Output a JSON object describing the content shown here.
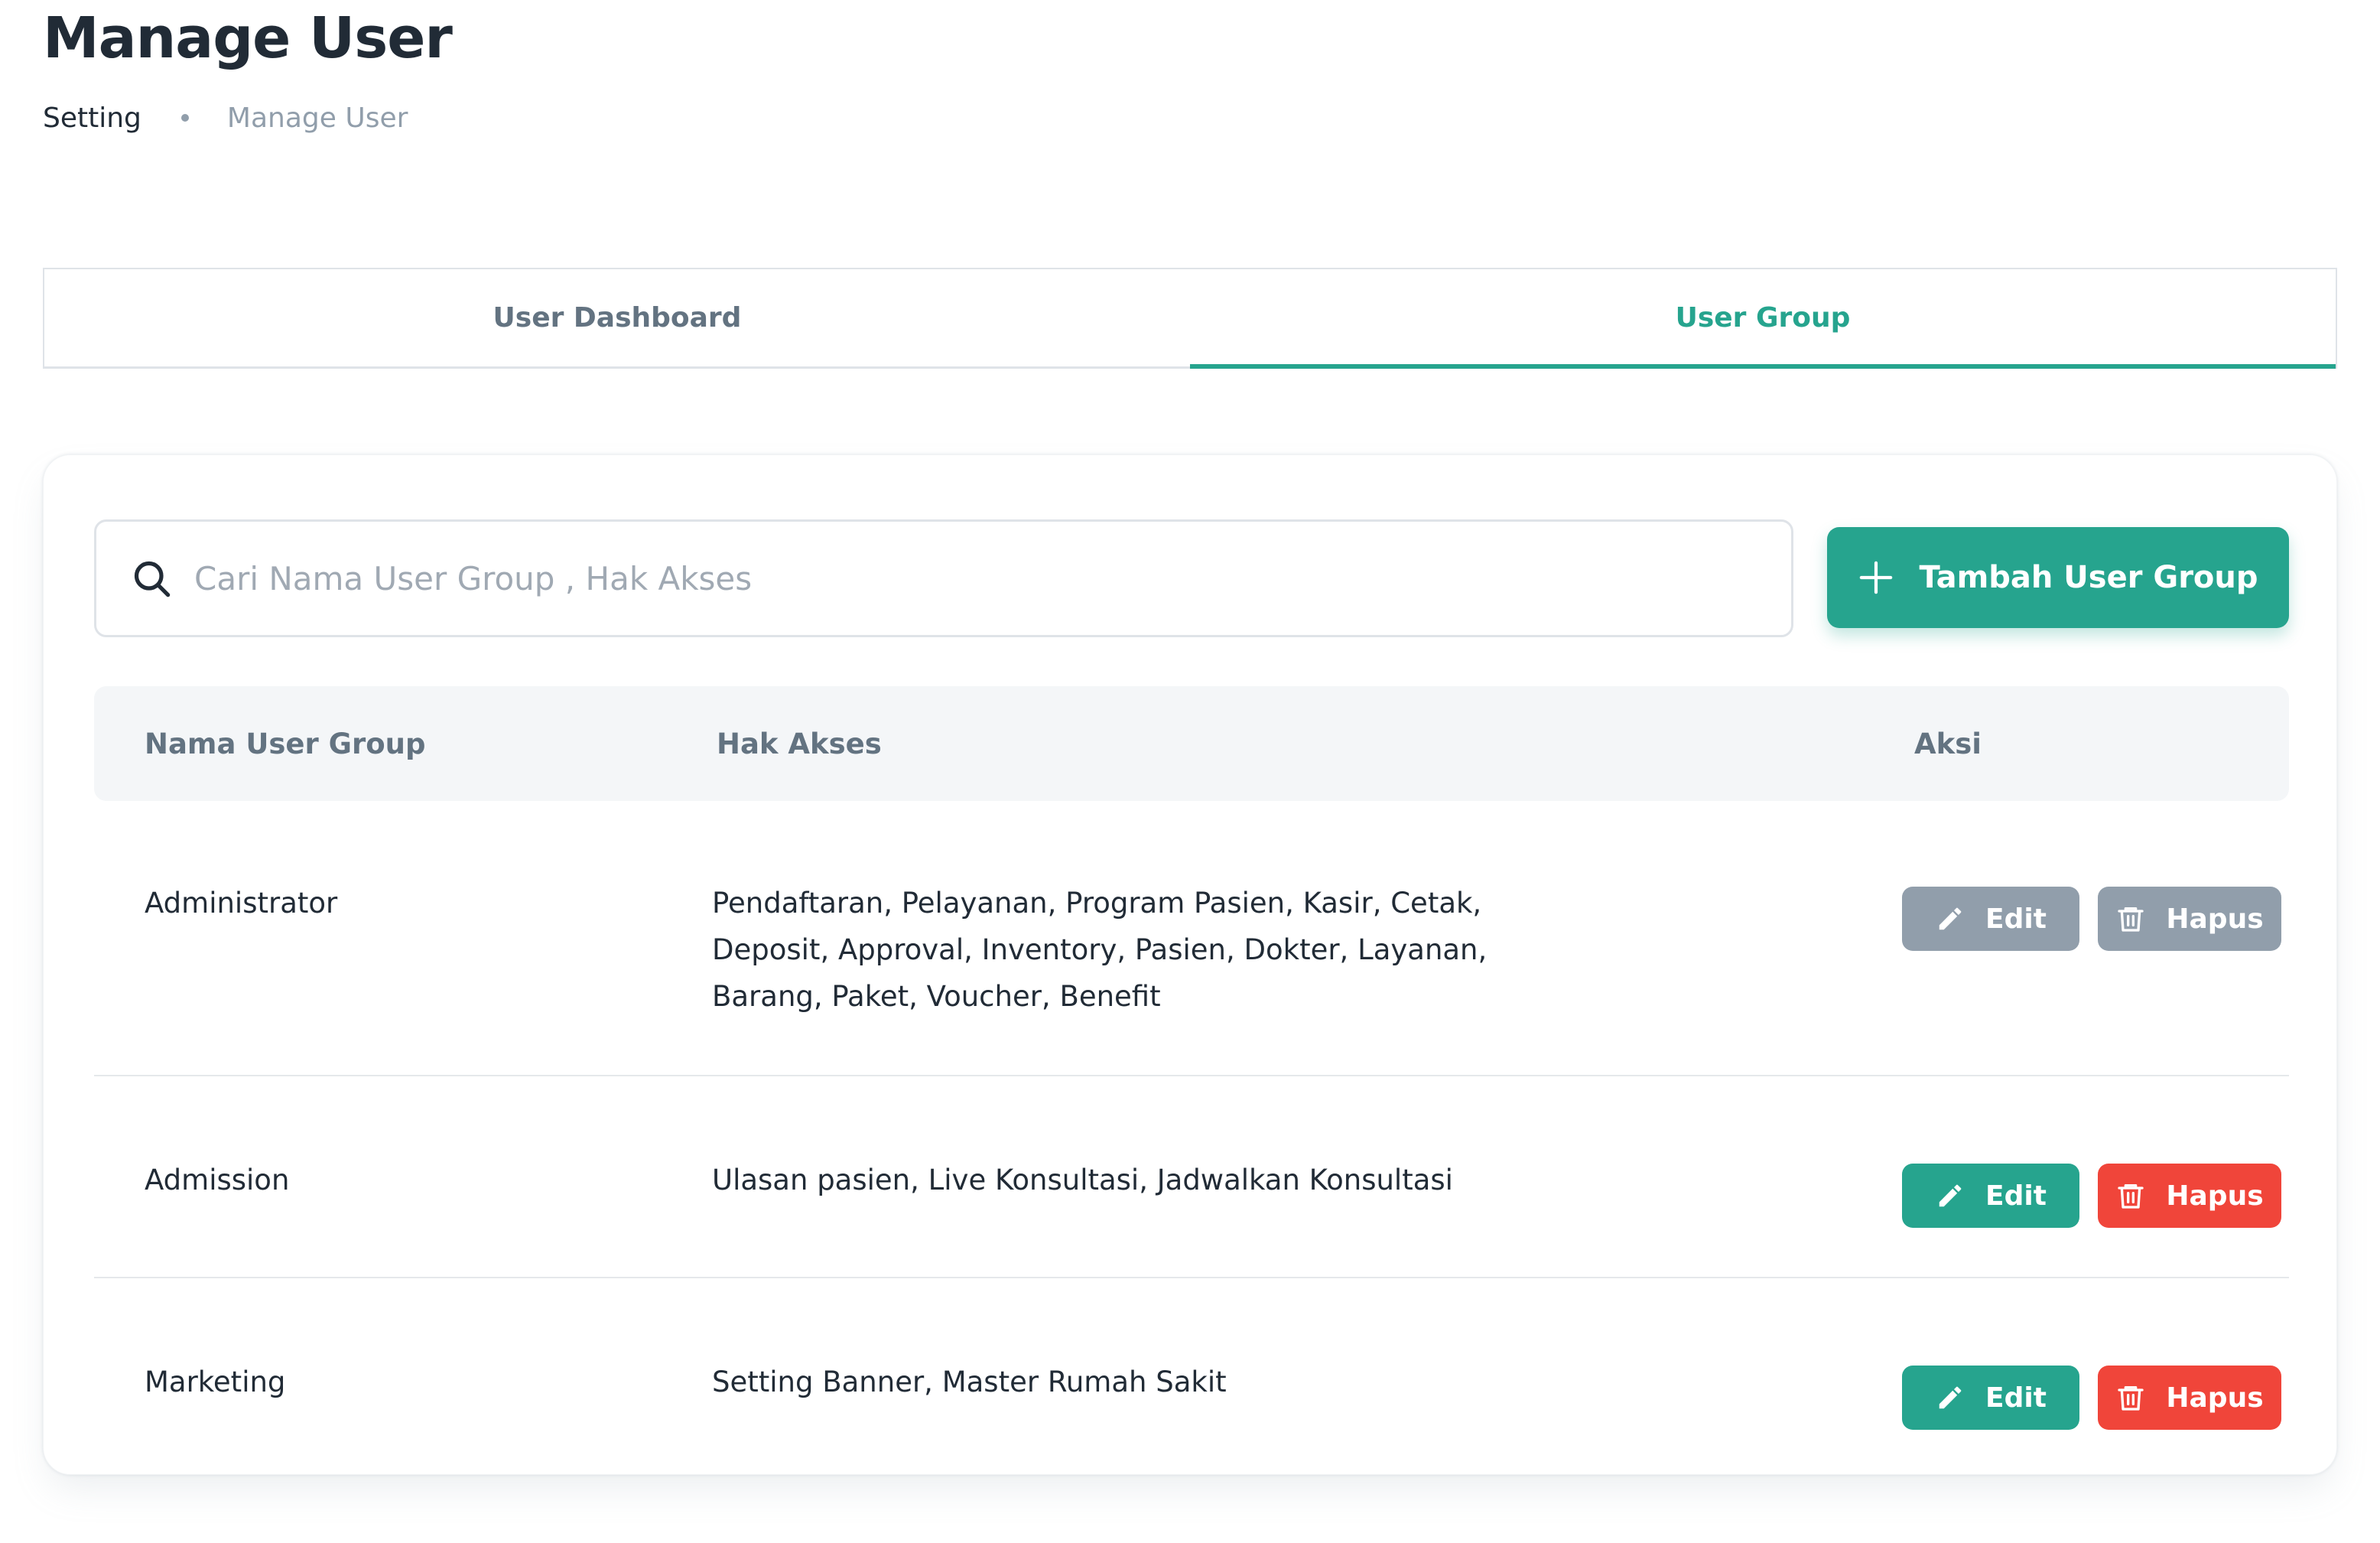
{
  "page": {
    "title": "Manage User"
  },
  "breadcrumb": {
    "parent": "Setting",
    "current": "Manage User"
  },
  "tabs": [
    {
      "label": "User Dashboard",
      "active": false
    },
    {
      "label": "User Group",
      "active": true
    }
  ],
  "search": {
    "placeholder": "Cari Nama User Group , Hak Akses",
    "value": "",
    "icon": "search-icon"
  },
  "add_button": {
    "label": "Tambah User Group",
    "icon": "plus-icon"
  },
  "table": {
    "headers": [
      "Nama User Group",
      "Hak Akses",
      "Aksi"
    ],
    "rows": [
      {
        "name": "Administrator",
        "access": "Pendaftaran, Pelayanan, Program Pasien, Kasir, Cetak, Deposit, Approval, Inventory, Pasien, Dokter, Layanan, Barang, Paket, Voucher, Benefit",
        "edit_label": "Edit",
        "delete_label": "Hapus",
        "actions_enabled": false
      },
      {
        "name": "Admission",
        "access": "Ulasan pasien, Live Konsultasi, Jadwalkan Konsultasi",
        "edit_label": "Edit",
        "delete_label": "Hapus",
        "actions_enabled": true
      },
      {
        "name": "Marketing",
        "access": "Setting Banner, Master Rumah Sakit",
        "edit_label": "Edit",
        "delete_label": "Hapus",
        "actions_enabled": true
      }
    ]
  },
  "colors": {
    "primary": "#26a48e",
    "danger": "#f0453a",
    "disabled": "#919eab",
    "text": "#212b36",
    "muted": "#637381"
  }
}
